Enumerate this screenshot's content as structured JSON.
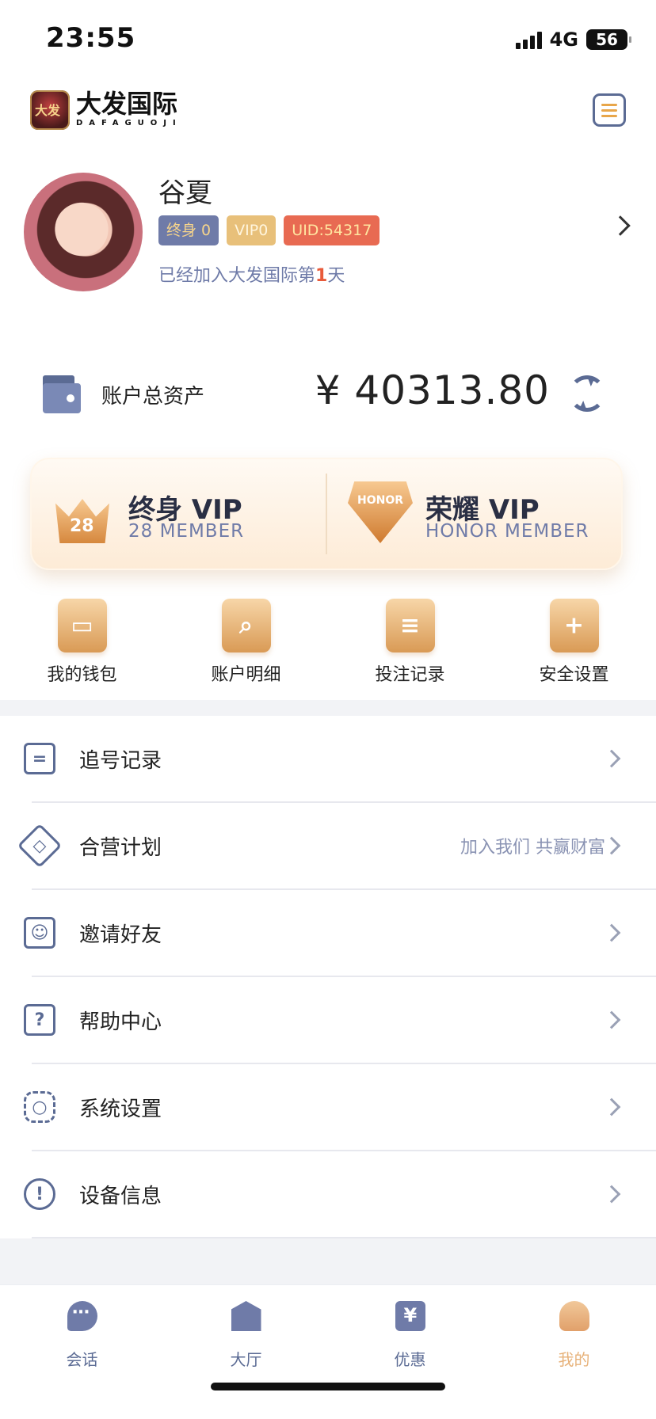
{
  "status_bar": {
    "time": "23:55",
    "network": "4G",
    "battery": "56"
  },
  "header": {
    "brand_name": "大发国际",
    "brand_sub": "DAFAGUOJI"
  },
  "profile": {
    "username": "谷夏",
    "badge_life": "终身 0",
    "badge_vip": "VIP0",
    "badge_uid": "UID:54317",
    "join_prefix": "已经加入大发国际第",
    "join_days": "1",
    "join_suffix": "天"
  },
  "assets": {
    "label": "账户总资产",
    "amount": "¥ 40313.80"
  },
  "vip": {
    "life": {
      "title": "终身 VIP",
      "subtitle": "28 MEMBER",
      "icon_text": "28"
    },
    "honor": {
      "title": "荣耀 VIP",
      "subtitle": "HONOR MEMBER",
      "icon_text": "HONOR"
    }
  },
  "quick_actions": [
    {
      "label": "我的钱包",
      "icon": "wallet-icon"
    },
    {
      "label": "账户明细",
      "icon": "search-icon"
    },
    {
      "label": "投注记录",
      "icon": "list-icon"
    },
    {
      "label": "安全设置",
      "icon": "shield-icon"
    }
  ],
  "menu": [
    {
      "label": "追号记录",
      "icon": "record-icon",
      "hint": ""
    },
    {
      "label": "合营计划",
      "icon": "handshake-icon",
      "hint": "加入我们 共赢财富"
    },
    {
      "label": "邀请好友",
      "icon": "invite-icon",
      "hint": ""
    },
    {
      "label": "帮助中心",
      "icon": "help-icon",
      "hint": ""
    },
    {
      "label": "系统设置",
      "icon": "gear-icon",
      "hint": ""
    },
    {
      "label": "设备信息",
      "icon": "info-icon",
      "hint": ""
    }
  ],
  "tabs": [
    {
      "label": "会话",
      "icon": "chat-icon"
    },
    {
      "label": "大厅",
      "icon": "bank-icon"
    },
    {
      "label": "优惠",
      "icon": "coupon-icon"
    },
    {
      "label": "我的",
      "icon": "user-icon",
      "active": true
    }
  ],
  "colors": {
    "accent_gold": "#e7b27a",
    "nav_blue": "#5b6b94",
    "uid_red": "#e86a52"
  }
}
